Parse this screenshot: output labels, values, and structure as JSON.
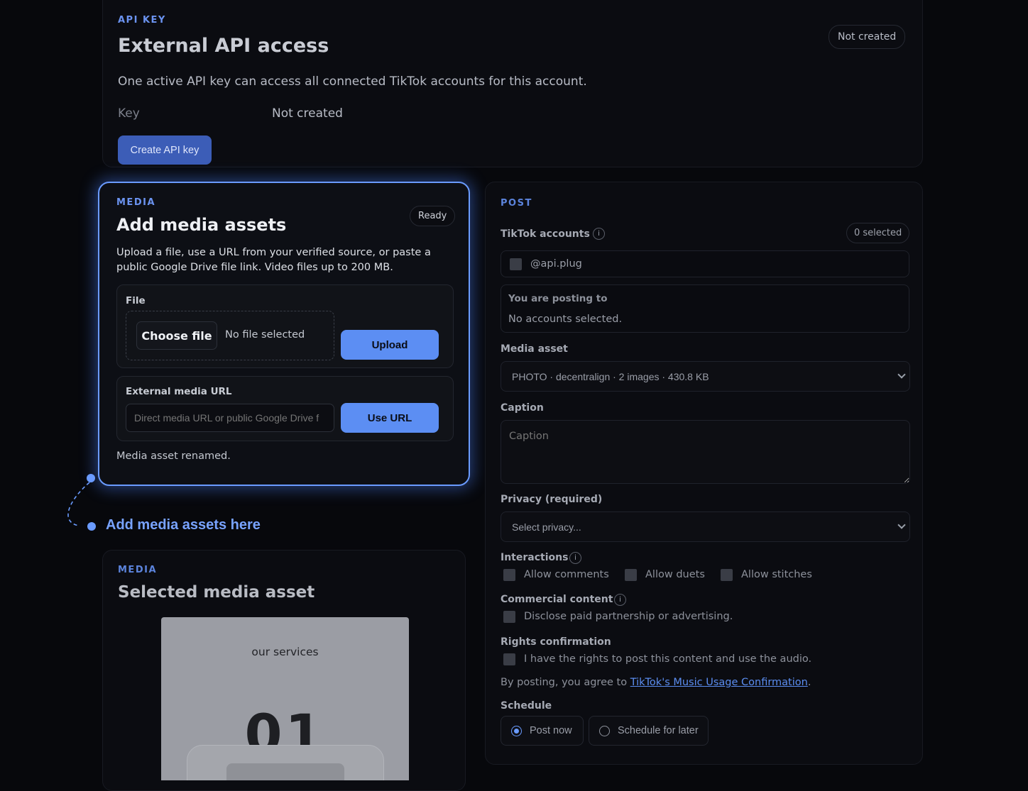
{
  "api_card": {
    "eyebrow": "API KEY",
    "title": "External API access",
    "status_badge": "Not created",
    "description": "One active API key can access all connected TikTok accounts for this account.",
    "key_label": "Key",
    "key_value": "Not created",
    "create_button": "Create API key"
  },
  "media_card": {
    "eyebrow": "MEDIA",
    "title": "Add media assets",
    "status_badge": "Ready",
    "description": "Upload a file, use a URL from your verified source, or paste a public Google Drive file link. Video files up to 200 MB.",
    "file_label": "File",
    "choose_file_button": "Choose file",
    "no_file_text": "No file selected",
    "upload_button": "Upload",
    "url_label": "External media URL",
    "url_placeholder": "Direct media URL or public Google Drive f",
    "use_url_button": "Use URL",
    "status_message": "Media asset renamed."
  },
  "callout": {
    "text": "Add media assets here"
  },
  "selected_card": {
    "eyebrow": "MEDIA",
    "title": "Selected media asset",
    "preview_title": "our services",
    "preview_number": "01"
  },
  "post_card": {
    "eyebrow": "POST",
    "accounts_label": "TikTok accounts",
    "accounts_count": "0 selected",
    "account_handle": "@api.plug",
    "posting_to_label": "You are posting to",
    "posting_to_value": "No accounts selected.",
    "media_asset_label": "Media asset",
    "media_asset_value": "PHOTO · decentralign · 2 images · 430.8 KB",
    "caption_label": "Caption",
    "caption_placeholder": "Caption",
    "privacy_label": "Privacy (required)",
    "privacy_value": "Select privacy...",
    "interactions_label": "Interactions",
    "allow_comments": "Allow comments",
    "allow_duets": "Allow duets",
    "allow_stitches": "Allow stitches",
    "commercial_label": "Commercial content",
    "commercial_checkbox": "Disclose paid partnership or advertising.",
    "rights_label": "Rights confirmation",
    "rights_checkbox": "I have the rights to post this content and use the audio.",
    "agree_prefix": "By posting, you agree to ",
    "agree_link": "TikTok's Music Usage Confirmation",
    "agree_suffix": ".",
    "schedule_label": "Schedule",
    "post_now": "Post now",
    "schedule_later": "Schedule for later"
  },
  "colors": {
    "accent": "#5c8ef3",
    "eyebrow": "#6b93f0",
    "background": "#07080c",
    "card": "#0b0c11",
    "link": "#5b8df0"
  }
}
